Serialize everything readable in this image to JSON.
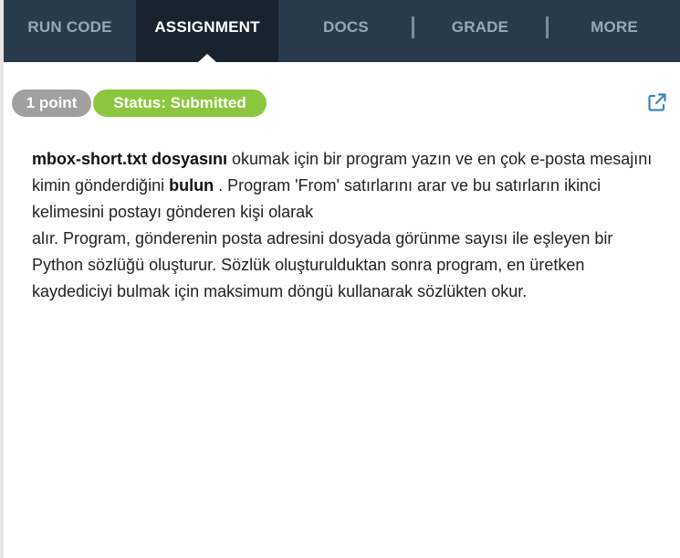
{
  "nav": {
    "tabs": [
      {
        "label": "RUN CODE",
        "active": false
      },
      {
        "label": "ASSIGNMENT",
        "active": true
      },
      {
        "label": "DOCS",
        "active": false
      },
      {
        "label": "GRADE",
        "active": false
      },
      {
        "label": "MORE",
        "active": false
      }
    ]
  },
  "assignment": {
    "points_badge": "1 point",
    "status_badge": "Status: Submitted",
    "external_link_icon": "external-link-icon",
    "description": {
      "filename": "mbox-short.txt dosyasını",
      "part1": " okumak için bir program yazın ve en çok e-posta mesajını kimin gönderdiğini ",
      "verb": "bulun",
      "part2": " . Program 'From' satırlarını arar ve bu satırların ikinci kelimesini postayı gönderen kişi olarak ",
      "part3": "alır. Program, gönderenin posta adresini dosyada görünme sayısı ile eşleyen bir Python sözlüğü oluşturur. Sözlük oluşturulduktan sonra program, en üretken kaydediciyi bulmak için maksimum döngü kullanarak sözlükten okur."
    }
  },
  "colors": {
    "nav_bg": "#2a3a4d",
    "nav_active_bg": "#18232f",
    "nav_text": "#9aa7b5",
    "points_badge_bg": "#a0a0a0",
    "status_badge_bg": "#8cc63f",
    "link_blue": "#3a86b7"
  }
}
